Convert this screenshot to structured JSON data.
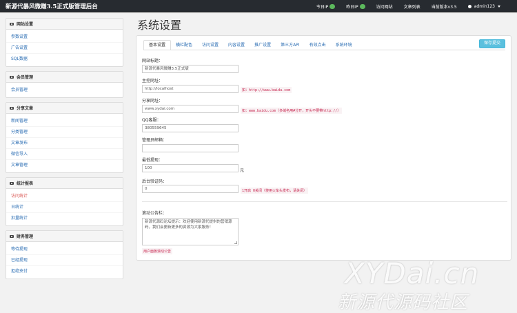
{
  "app": {
    "title": "新源代暴风微赚3.5正式版管理后台"
  },
  "topnav": {
    "today_ip_label": "今日IP",
    "today_ip_value": "",
    "yesterday_ip_label": "昨日IP",
    "yesterday_ip_value": "",
    "visit_site": "访问网站",
    "article_list": "文章列表",
    "current_version": "当前版本v3.5",
    "user": "admin123"
  },
  "sidebar": {
    "sections": [
      {
        "title": "网站设置",
        "items": [
          "参数设置",
          "广告设置",
          "SQL数据"
        ]
      },
      {
        "title": "会员管理",
        "items": [
          "会员管理"
        ]
      },
      {
        "title": "分享文章",
        "items": [
          "新闻管理",
          "分类管理",
          "文章发布",
          "微信导入",
          "文章管理"
        ]
      },
      {
        "title": "统计报表",
        "items": [
          "访问统计",
          "日统计",
          "扣量统计"
        ]
      },
      {
        "title": "财务管理",
        "items": [
          "等待提现",
          "已经提现",
          "拒绝支付"
        ]
      }
    ],
    "active_item": "访问统计"
  },
  "main": {
    "page_title": "系统设置",
    "save_label": "保存提交",
    "tabs": [
      "基本设置",
      "横栏配色",
      "访问设置",
      "内容设置",
      "推广设置",
      "第三方API",
      "有效点击",
      "系统环境"
    ],
    "fields": {
      "site_title_label": "网站标题：",
      "site_title_value": "新源代暴风微赚3.5正式版",
      "main_domain_label": "主控网址：",
      "main_domain_value": "http://localhost",
      "main_domain_hint": "如：http://www.baidu.com",
      "share_domain_label": "分享网址：",
      "share_domain_value": "www.xydai.com",
      "share_domain_hint": "如：www.baidu.com（多域名用#分开，开头不要带http://）",
      "qq_group_label": "QQ客服：",
      "qq_group_value": "380559645",
      "admin_email_label": "管理员邮箱：",
      "admin_email_value": "",
      "min_withdraw_label": "最低提现：",
      "min_withdraw_value": "100",
      "min_withdraw_unit": "元",
      "verify_code_label": "后台验证码：",
      "verify_code_value": "0",
      "verify_code_hint": "1开启 0关闭（使用火车头发布，请关闭）",
      "notice_label": "滚动公告栏：",
      "notice_value": "新源代源码论坛提示：欢迎使用新源代提供的营销源码，我们会更新更多的资源为大家服务！",
      "notice_button": "用户面板滚动公告"
    }
  },
  "watermark": {
    "en": "XYDai.cn",
    "cn": "新源代源码社区"
  }
}
